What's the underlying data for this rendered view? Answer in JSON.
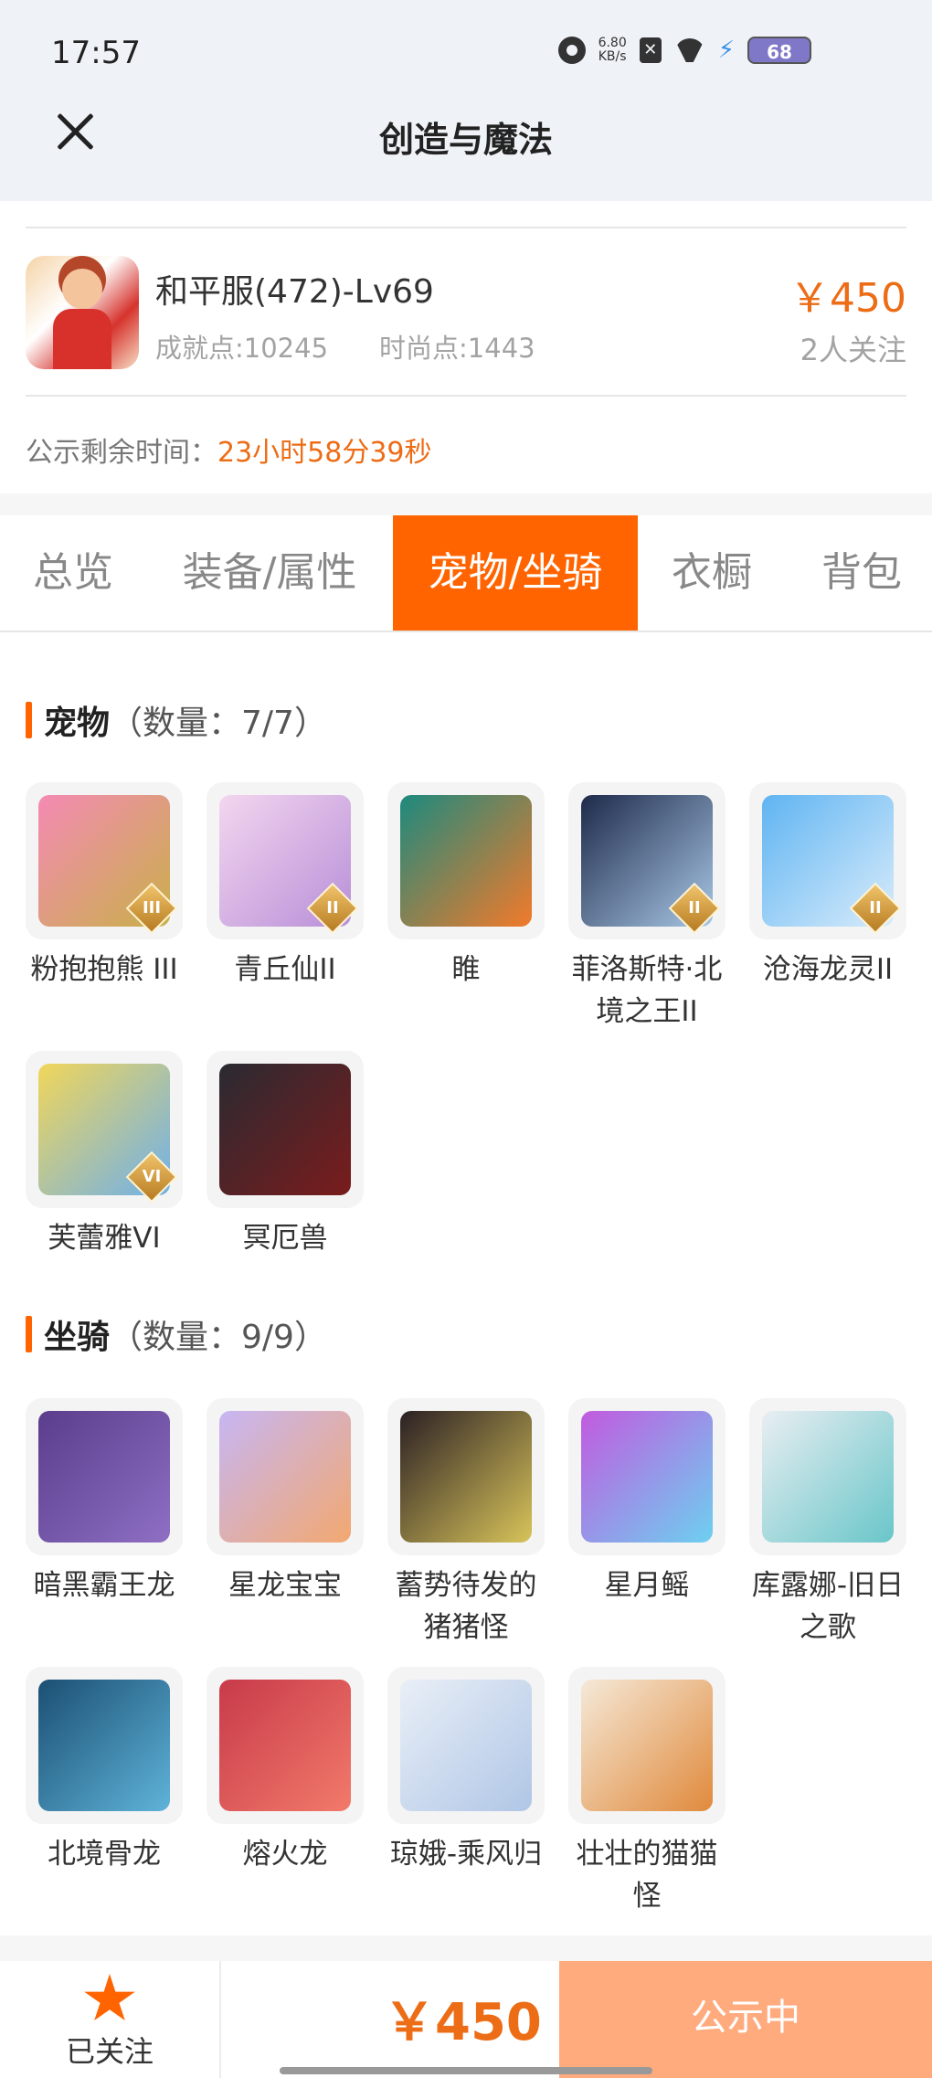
{
  "status_bar": {
    "time": "17:57",
    "net_speed_value": "6.80",
    "net_speed_unit": "KB/s",
    "battery": "68"
  },
  "header": {
    "title": "创造与魔法"
  },
  "account": {
    "server_level": "和平服(472)-Lv69",
    "achievement": "成就点:10245",
    "fashion": "时尚点:1443",
    "price": "￥450",
    "followers": "2人关注",
    "countdown_label": "公示剩余时间：",
    "countdown_value": "23小时58分39秒"
  },
  "tabs": [
    {
      "label": "总览",
      "active": false
    },
    {
      "label": "装备/属性",
      "active": false
    },
    {
      "label": "宠物/坐骑",
      "active": true
    },
    {
      "label": "衣橱",
      "active": false
    },
    {
      "label": "背包",
      "active": false
    }
  ],
  "pets": {
    "title": "宠物",
    "count": "（数量：7/7）",
    "items": [
      {
        "name": "粉抱抱熊 III",
        "badge": "III",
        "colors": [
          "#f48ab4",
          "#c9b04a"
        ]
      },
      {
        "name": "青丘仙II",
        "badge": "II",
        "colors": [
          "#f3d6ef",
          "#b88fd8"
        ]
      },
      {
        "name": "睢",
        "badge": "",
        "colors": [
          "#1c8a7e",
          "#f27a2a"
        ]
      },
      {
        "name": "菲洛斯特·北境之王II",
        "badge": "II",
        "colors": [
          "#1e2a4a",
          "#a9c7e6"
        ]
      },
      {
        "name": "沧海龙灵II",
        "badge": "II",
        "colors": [
          "#5fb4f2",
          "#d9ecfb"
        ]
      },
      {
        "name": "芙蕾雅VI",
        "badge": "VI",
        "colors": [
          "#f1d65a",
          "#6fb0ea"
        ]
      },
      {
        "name": "冥厄兽",
        "badge": "",
        "colors": [
          "#2a2a32",
          "#7a1c1c"
        ]
      }
    ]
  },
  "mounts": {
    "title": "坐骑",
    "count": "（数量：9/9）",
    "items": [
      {
        "name": "暗黑霸王龙",
        "colors": [
          "#5a3d8c",
          "#8e6fc4"
        ]
      },
      {
        "name": "星龙宝宝",
        "colors": [
          "#c7b6f4",
          "#f2a870"
        ]
      },
      {
        "name": "蓄势待发的猪猪怪",
        "colors": [
          "#2b2024",
          "#d8c45a"
        ]
      },
      {
        "name": "星月鳐",
        "colors": [
          "#c25adf",
          "#6dd0f0"
        ]
      },
      {
        "name": "库露娜-旧日之歌",
        "colors": [
          "#e9eef2",
          "#69c6c9"
        ]
      },
      {
        "name": "北境骨龙",
        "colors": [
          "#1b4f73",
          "#5fb3d9"
        ]
      },
      {
        "name": "熔火龙",
        "colors": [
          "#c83a4a",
          "#f27a6a"
        ]
      },
      {
        "name": "琼娥-乘风归",
        "colors": [
          "#e9eff7",
          "#b0c6e6"
        ]
      },
      {
        "name": "壮壮的猫猫怪",
        "colors": [
          "#f5e9d8",
          "#e08a3c"
        ]
      }
    ]
  },
  "bottom_bar": {
    "follow_label": "已关注",
    "price": "￥450",
    "status_button": "公示中"
  },
  "theme": {
    "accent": "#ff6400",
    "price": "#ed6c16",
    "muted": "#a3a3a3",
    "status_button_bg": "#ffab7e"
  }
}
